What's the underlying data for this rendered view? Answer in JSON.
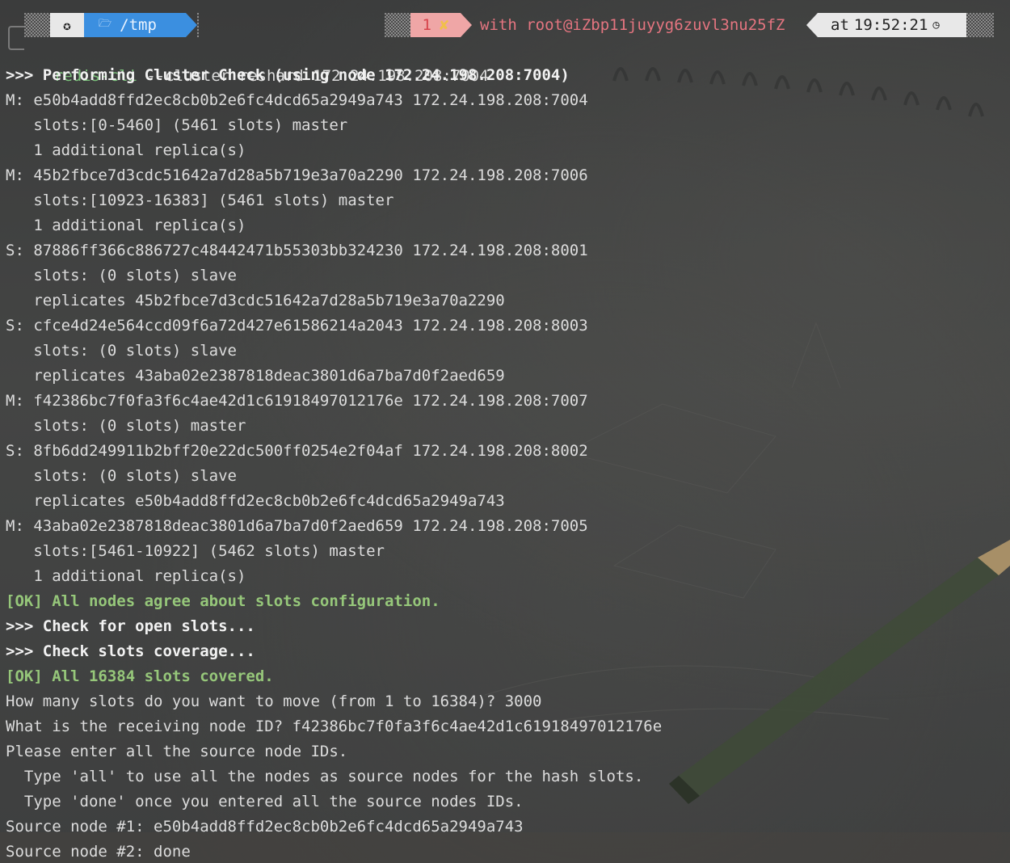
{
  "prompt": {
    "os_icon": "circle-dot-icon",
    "dir_icon": "folder-open-icon",
    "dir": "/tmp",
    "exit_code": "1",
    "exit_icon": "cross-icon",
    "exit_glyph": "✘",
    "host": "with root@iZbp11juyyg6zuvl3nu25fZ",
    "time_prefix": "at",
    "time": "19:52:21",
    "time_icon": "clock-icon",
    "colors": {
      "dir_bg": "#3b8fe0",
      "err_bg": "#efa6a6",
      "err_fg": "#d6424a",
      "host_fg": "#e57580",
      "cmd_fg": "#7cc37c",
      "ok_fg": "#96c77a"
    }
  },
  "command": {
    "name": "redis-cli",
    "args": " --cluster reshard 172.24.198.208:7004"
  },
  "output": [
    {
      "text": ">>> Performing Cluster Check (using node 172.24.198.208:7004)",
      "style": "bold"
    },
    {
      "text": "M: e50b4add8ffd2ec8cb0b2e6fc4dcd65a2949a743 172.24.198.208:7004",
      "style": "plain"
    },
    {
      "text": "   slots:[0-5460] (5461 slots) master",
      "style": "plain"
    },
    {
      "text": "   1 additional replica(s)",
      "style": "plain"
    },
    {
      "text": "M: 45b2fbce7d3cdc51642a7d28a5b719e3a70a2290 172.24.198.208:7006",
      "style": "plain"
    },
    {
      "text": "   slots:[10923-16383] (5461 slots) master",
      "style": "plain"
    },
    {
      "text": "   1 additional replica(s)",
      "style": "plain"
    },
    {
      "text": "S: 87886ff366c886727c48442471b55303bb324230 172.24.198.208:8001",
      "style": "plain"
    },
    {
      "text": "   slots: (0 slots) slave",
      "style": "plain"
    },
    {
      "text": "   replicates 45b2fbce7d3cdc51642a7d28a5b719e3a70a2290",
      "style": "plain"
    },
    {
      "text": "S: cfce4d24e564ccd09f6a72d427e61586214a2043 172.24.198.208:8003",
      "style": "plain"
    },
    {
      "text": "   slots: (0 slots) slave",
      "style": "plain"
    },
    {
      "text": "   replicates 43aba02e2387818deac3801d6a7ba7d0f2aed659",
      "style": "plain"
    },
    {
      "text": "M: f42386bc7f0fa3f6c4ae42d1c61918497012176e 172.24.198.208:7007",
      "style": "plain"
    },
    {
      "text": "   slots: (0 slots) master",
      "style": "plain"
    },
    {
      "text": "S: 8fb6dd249911b2bff20e22dc500ff0254e2f04af 172.24.198.208:8002",
      "style": "plain"
    },
    {
      "text": "   slots: (0 slots) slave",
      "style": "plain"
    },
    {
      "text": "   replicates e50b4add8ffd2ec8cb0b2e6fc4dcd65a2949a743",
      "style": "plain"
    },
    {
      "text": "M: 43aba02e2387818deac3801d6a7ba7d0f2aed659 172.24.198.208:7005",
      "style": "plain"
    },
    {
      "text": "   slots:[5461-10922] (5462 slots) master",
      "style": "plain"
    },
    {
      "text": "   1 additional replica(s)",
      "style": "plain"
    },
    {
      "text": "[OK] All nodes agree about slots configuration.",
      "style": "ok"
    },
    {
      "text": ">>> Check for open slots...",
      "style": "bold"
    },
    {
      "text": ">>> Check slots coverage...",
      "style": "bold"
    },
    {
      "text": "[OK] All 16384 slots covered.",
      "style": "ok"
    },
    {
      "text": "How many slots do you want to move (from 1 to 16384)? 3000",
      "style": "plain"
    },
    {
      "text": "What is the receiving node ID? f42386bc7f0fa3f6c4ae42d1c61918497012176e",
      "style": "plain"
    },
    {
      "text": "Please enter all the source node IDs.",
      "style": "plain"
    },
    {
      "text": "  Type 'all' to use all the nodes as source nodes for the hash slots.",
      "style": "plain"
    },
    {
      "text": "  Type 'done' once you entered all the source nodes IDs.",
      "style": "plain"
    },
    {
      "text": "Source node #1: e50b4add8ffd2ec8cb0b2e6fc4dcd65a2949a743",
      "style": "plain"
    },
    {
      "text": "Source node #2: done",
      "style": "plain"
    }
  ]
}
